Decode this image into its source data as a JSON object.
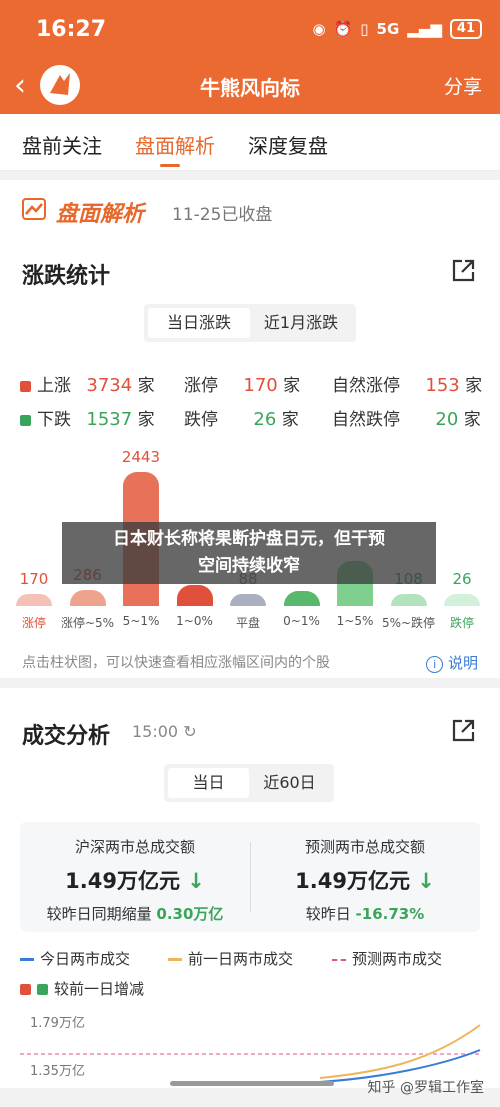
{
  "status": {
    "time": "16:27",
    "signal": "5G",
    "battery": "41"
  },
  "topbar": {
    "title": "牛熊风向标",
    "share": "分享"
  },
  "tabs": [
    "盘前关注",
    "盘面解析",
    "深度复盘"
  ],
  "section1": {
    "brand": "盘面解析",
    "date": "11-25已收盘",
    "heading": "涨跌统计",
    "seg": [
      "当日涨跌",
      "近1月涨跌"
    ],
    "stats": [
      {
        "label": "上涨",
        "value": "3734",
        "unit": "家",
        "color": "#e0503a"
      },
      {
        "label": "涨停",
        "value": "170",
        "unit": "家"
      },
      {
        "label": "自然涨停",
        "value": "153",
        "unit": "家"
      },
      {
        "label": "下跌",
        "value": "1537",
        "unit": "家",
        "color": "#3aa55a"
      },
      {
        "label": "跌停",
        "value": "26",
        "unit": "家"
      },
      {
        "label": "自然跌停",
        "value": "20",
        "unit": "家"
      }
    ]
  },
  "chart_data": {
    "type": "bar",
    "categories": [
      "涨停",
      "涨停~5%",
      "5~1%",
      "1~0%",
      "平盘",
      "0~1%",
      "1~5%",
      "5%~跌停",
      "跌停"
    ],
    "values": [
      170,
      286,
      2443,
      388,
      88,
      281,
      822,
      108,
      26
    ],
    "value_labels": [
      "170",
      "286",
      "2443",
      "",
      "88",
      "",
      "",
      "108",
      "26"
    ],
    "colors": [
      "#f3c1b6",
      "#eea38e",
      "#e8715a",
      "#e0503a",
      "#aab0c0",
      "#58b96e",
      "#7fcf8f",
      "#b3e3bd",
      "#d3f0da"
    ],
    "title": "",
    "xlabel": "",
    "ylabel": ""
  },
  "overlay": {
    "line1": "日本财长称将果断护盘日元，但干预",
    "line2": "空间持续收窄"
  },
  "hint": "点击柱状图，可以快速查看相应涨幅区间内的个股",
  "explain": "说明",
  "section2": {
    "heading": "成交分析",
    "time": "15:00",
    "seg": [
      "当日",
      "近60日"
    ],
    "kpi": [
      {
        "label": "沪深两市总成交额",
        "value": "1.49万亿元",
        "sub_label": "较昨日同期缩量",
        "sub_value": "0.30万亿"
      },
      {
        "label": "预测两市总成交额",
        "value": "1.49万亿元",
        "sub_label": "较昨日",
        "sub_value": "-16.73%"
      }
    ],
    "legend": [
      "今日两市成交",
      "前一日两市成交",
      "预测两市成交",
      "较前一日增减"
    ],
    "axis": [
      "1.79万亿",
      "1.35万亿"
    ]
  },
  "watermark": "知乎 @罗辑工作室"
}
